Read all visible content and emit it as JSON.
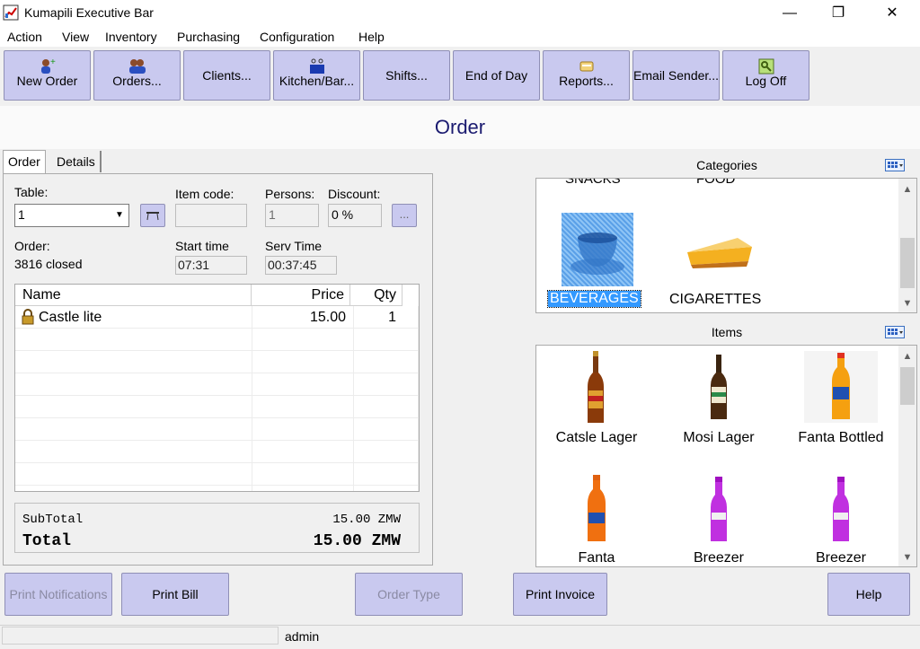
{
  "window": {
    "title": "Kumapili Executive Bar",
    "minimize": "—",
    "maximize": "❐",
    "close": "✕"
  },
  "menu": [
    "Action",
    "View",
    "Inventory",
    "Purchasing",
    "Configuration",
    "Help"
  ],
  "toolbar": {
    "new_order": "New Order",
    "orders": "Orders...",
    "clients": "Clients...",
    "kitchen_bar": "Kitchen/Bar...",
    "shifts": "Shifts...",
    "end_of_day": "End of Day",
    "reports": "Reports...",
    "email_sender": "Email Sender...",
    "log_off": "Log Off"
  },
  "page_title": "Order",
  "tabs": {
    "order": "Order",
    "details": "Details"
  },
  "form": {
    "table_label": "Table:",
    "table_value": "1",
    "item_code_label": "Item code:",
    "item_code_value": "",
    "persons_label": "Persons:",
    "persons_value": "1",
    "discount_label": "Discount:",
    "discount_value": "0 %",
    "more_button": "...",
    "order_label": "Order:",
    "order_value": "3816 closed",
    "start_time_label": "Start time",
    "start_time_value": "07:31",
    "serv_time_label": "Serv Time",
    "serv_time_value": "00:37:45"
  },
  "grid": {
    "headers": {
      "name": "Name",
      "price": "Price",
      "qty": "Qty"
    },
    "rows": [
      {
        "name": "Castle lite",
        "price": "15.00",
        "qty": "1"
      }
    ]
  },
  "totals": {
    "subtotal_label": "SubTotal",
    "subtotal_value": "15.00 ZMW",
    "total_label": "Total",
    "total_value": "15.00 ZMW"
  },
  "categories": {
    "title": "Categories",
    "partial_top": [
      "SNACKS",
      "FOOD"
    ],
    "items": [
      "BEVERAGES",
      "CIGARETTES"
    ],
    "selected": "BEVERAGES"
  },
  "items": {
    "title": "Items",
    "products": [
      "Catsle Lager",
      "Mosi Lager",
      "Fanta Bottled",
      "Fanta",
      "Breezer",
      "Breezer"
    ]
  },
  "bottom_buttons": {
    "print_notifications": "Print Notifications",
    "print_bill": "Print Bill",
    "order_type": "Order Type",
    "print_invoice": "Print Invoice",
    "help": "Help"
  },
  "status": {
    "user": "admin"
  },
  "colors": {
    "button": "#c9c9ef",
    "title": "#1b1b70",
    "selection": "#3399ff"
  }
}
